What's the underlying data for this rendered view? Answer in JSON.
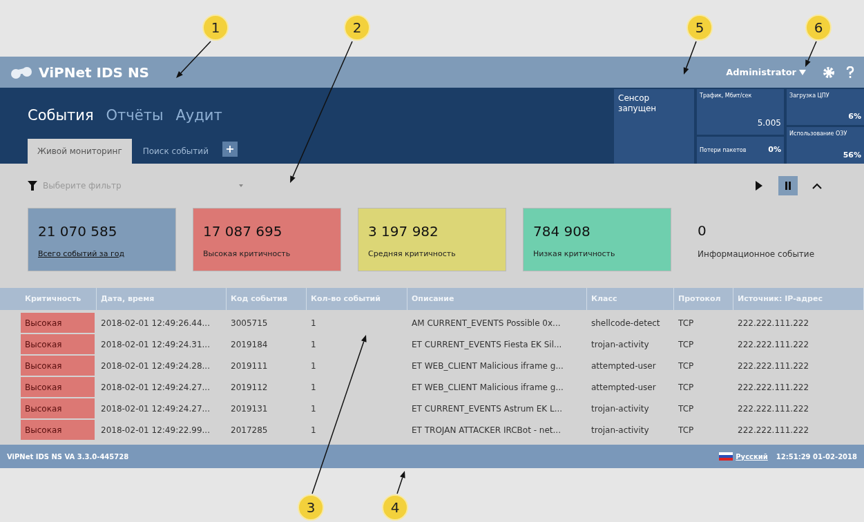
{
  "header": {
    "title": "ViPNet IDS NS",
    "user": "Administrator"
  },
  "main_tabs": [
    {
      "label": "События",
      "selected": true
    },
    {
      "label": "Отчёты",
      "selected": false
    },
    {
      "label": "Аудит",
      "selected": false
    }
  ],
  "sub_tabs": [
    {
      "label": "Живой мониторинг",
      "selected": true
    },
    {
      "label": "Поиск событий",
      "selected": false
    }
  ],
  "add_tab": "+",
  "status": {
    "sensor": "Сенсор запущен",
    "traffic_label": "Трафик, Мбит/сек",
    "traffic": "5.005",
    "loss_label": "Потери пакетов",
    "loss": "0%",
    "cpu_label": "Загрузка ЦПУ",
    "cpu": "6%",
    "ram_label": "Использование ОЗУ",
    "ram": "56%"
  },
  "filter": {
    "placeholder": "Выберите фильтр"
  },
  "playback": [
    {
      "kind": "play",
      "selected": false
    },
    {
      "kind": "pause",
      "selected": true
    },
    {
      "kind": "collapse",
      "selected": false
    }
  ],
  "cards": [
    {
      "value": "21 070 585",
      "label": "Всего событий за год",
      "kind": "link",
      "color": "#7f9bb8"
    },
    {
      "value": "17 087 695",
      "label": "Высокая критичность",
      "kind": "text",
      "color": "#dc7874"
    },
    {
      "value": "3 197 982",
      "label": "Средняя критичность",
      "kind": "text",
      "color": "#dcd676"
    },
    {
      "value": "784 908",
      "label": "Низкая критичность",
      "kind": "text",
      "color": "#6fcfae"
    },
    {
      "value": "0",
      "label": "Информационное событие",
      "kind": "plain"
    }
  ],
  "table": {
    "columns": [
      "Критичность",
      "Дата, время",
      "Код события",
      "Кол-во событий",
      "Описание",
      "Класс",
      "Протокол",
      "Источник: IP-адрес"
    ],
    "rows": [
      [
        "Высокая",
        "2018-02-01 12:49:26.44...",
        "3005715",
        "1",
        "AM CURRENT_EVENTS Possible 0x...",
        "shellcode-detect",
        "TCP",
        "222.222.111.222"
      ],
      [
        "Высокая",
        "2018-02-01 12:49:24.31...",
        "2019184",
        "1",
        "ET CURRENT_EVENTS Fiesta EK Sil...",
        "trojan-activity",
        "TCP",
        "222.222.111.222"
      ],
      [
        "Высокая",
        "2018-02-01 12:49:24.28...",
        "2019111",
        "1",
        "ET WEB_CLIENT Malicious iframe g...",
        "attempted-user",
        "TCP",
        "222.222.111.222"
      ],
      [
        "Высокая",
        "2018-02-01 12:49:24.27...",
        "2019112",
        "1",
        "ET WEB_CLIENT Malicious iframe g...",
        "attempted-user",
        "TCP",
        "222.222.111.222"
      ],
      [
        "Высокая",
        "2018-02-01 12:49:24.27...",
        "2019131",
        "1",
        "ET CURRENT_EVENTS Astrum EK L...",
        "trojan-activity",
        "TCP",
        "222.222.111.222"
      ],
      [
        "Высокая",
        "2018-02-01 12:49:22.99...",
        "2017285",
        "1",
        "ET TROJAN ATTACKER IRCBot - net...",
        "trojan-activity",
        "TCP",
        "222.222.111.222"
      ]
    ]
  },
  "status_bar": {
    "version": "ViPNet IDS NS VA 3.3.0-445728",
    "language": "Русский",
    "datetime": "12:51:29 01-02-2018"
  },
  "callouts": [
    {
      "label": "1"
    },
    {
      "label": "2"
    },
    {
      "label": "5"
    },
    {
      "label": "6"
    },
    {
      "label": "3"
    },
    {
      "label": "4"
    }
  ]
}
